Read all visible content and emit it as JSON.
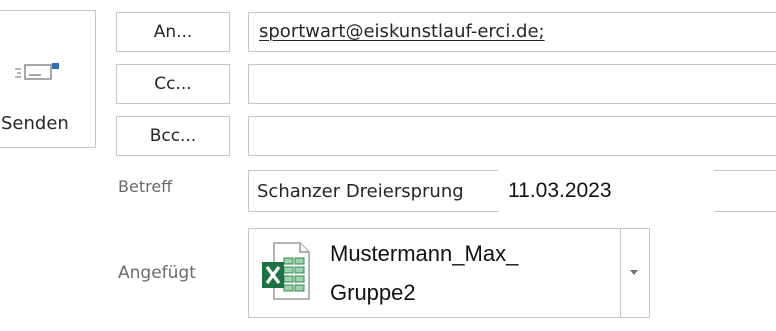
{
  "send": {
    "label": "Senden",
    "icon": "send-envelope-icon"
  },
  "recipients": {
    "to_label": "An...",
    "cc_label": "Cc...",
    "bcc_label": "Bcc...",
    "to_value": "sportwart@eiskunstlauf-erci.de;",
    "cc_value": "",
    "bcc_value": ""
  },
  "subject": {
    "label": "Betreff",
    "value": "Schanzer Dreiersprung",
    "overlay": "11.03.2023"
  },
  "attachment": {
    "label": "Angefügt",
    "icon": "excel-file-icon",
    "name_line1": "Mustermann_Max_",
    "name_line2": "Gruppe2"
  }
}
